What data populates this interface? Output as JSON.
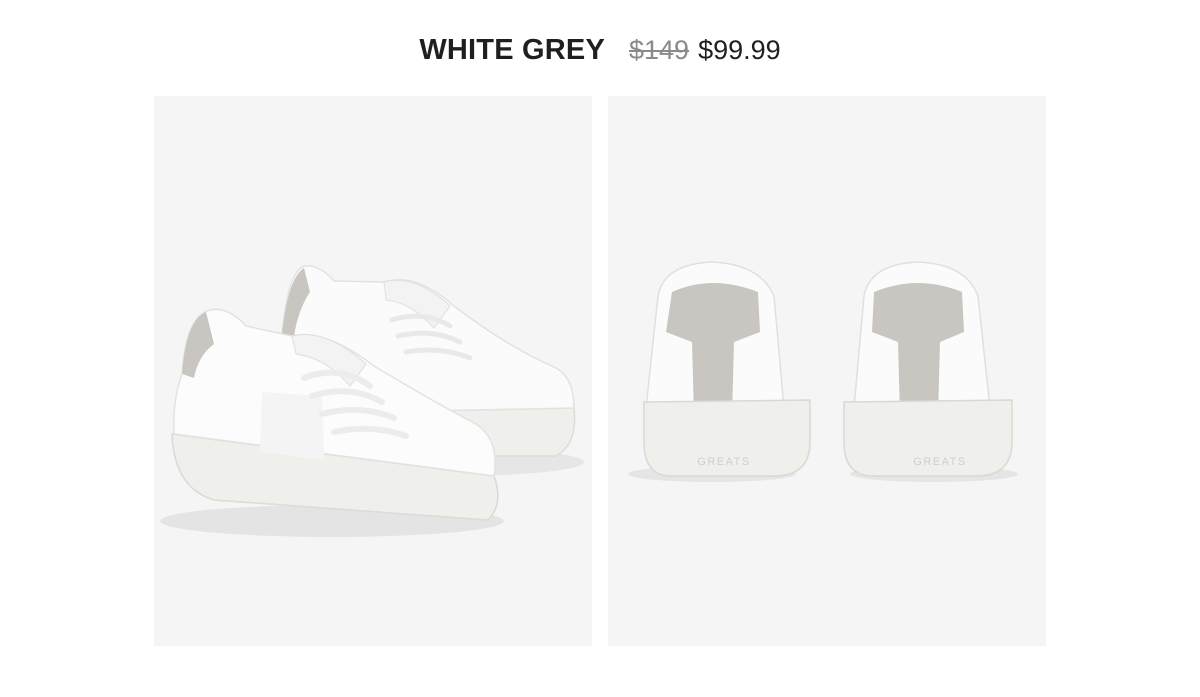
{
  "product": {
    "color_name": "WHITE GREY",
    "original_price": "$149",
    "sale_price": "$99.99"
  },
  "images": {
    "left": {
      "icon": "sneaker-pair-side-view-image"
    },
    "right": {
      "icon": "sneaker-pair-back-view-image",
      "heel_brand_left": "GREATS",
      "heel_brand_right": "GREATS"
    }
  },
  "colors": {
    "panel_background": "#f5f5f5",
    "text": "#1f1f1f",
    "strikethrough_price": "#8a8a8a",
    "upper_white": "#fbfbfb",
    "sole_white": "#efefeb",
    "heel_grey": "#c9c6c2"
  }
}
